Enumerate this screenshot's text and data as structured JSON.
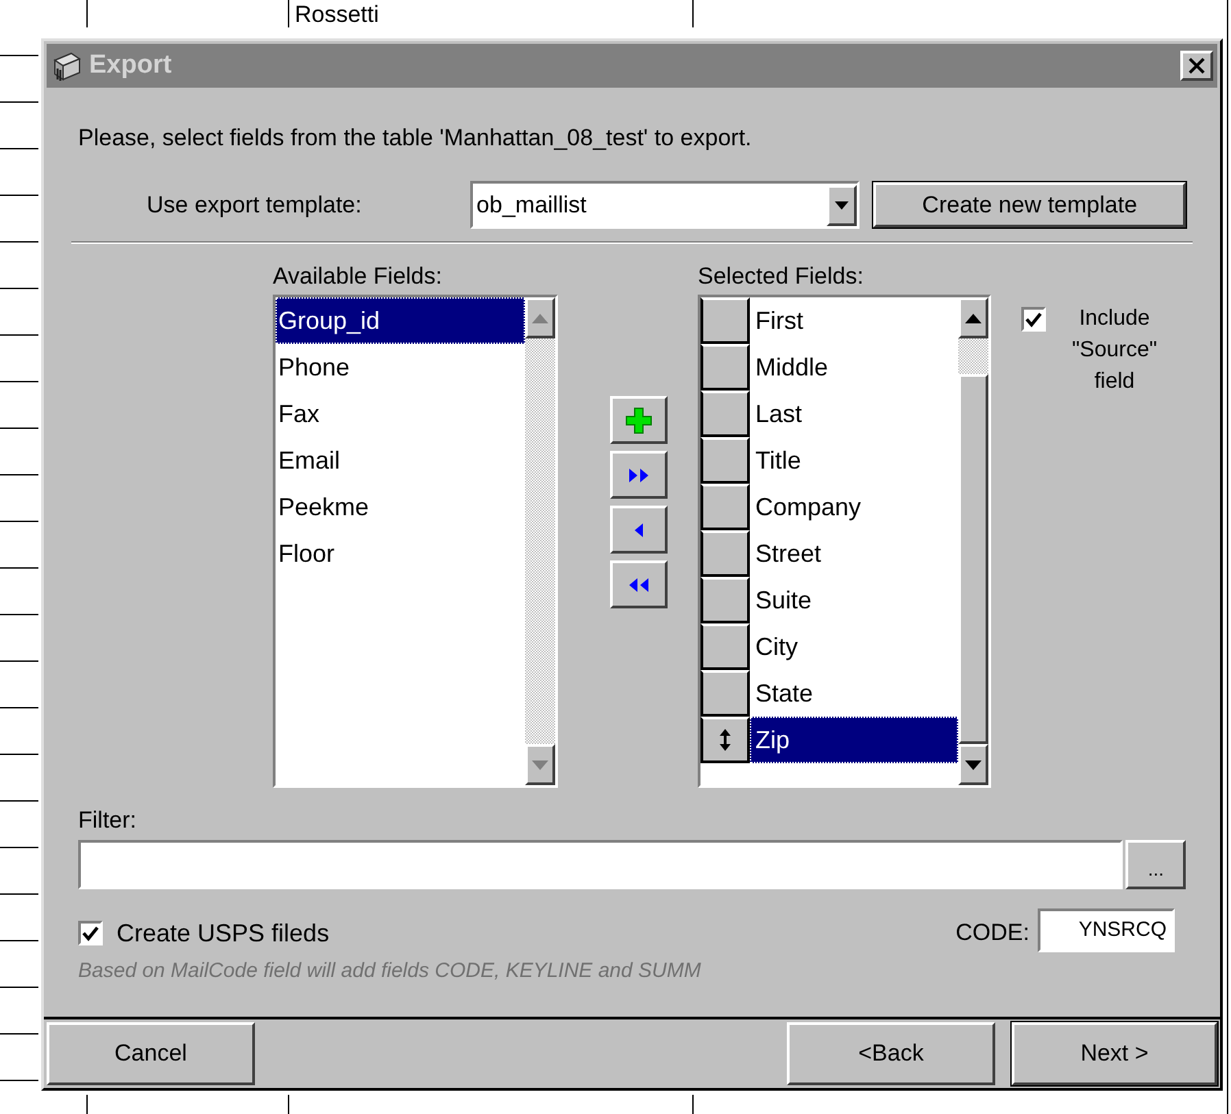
{
  "background_sheet": {
    "cells": [
      "Rossetti"
    ]
  },
  "window": {
    "title": "Export"
  },
  "message": "Please, select fields from the table 'Manhattan_08_test' to export.",
  "template": {
    "label": "Use export template:",
    "value": "ob_maillist",
    "create_button": "Create new template"
  },
  "available_fields": {
    "label": "Available Fields:",
    "items": [
      {
        "label": "Group_id",
        "selected": true
      },
      {
        "label": "Phone",
        "selected": false
      },
      {
        "label": "Fax",
        "selected": false
      },
      {
        "label": "Email",
        "selected": false
      },
      {
        "label": "Peekme",
        "selected": false
      },
      {
        "label": "Floor",
        "selected": false
      }
    ]
  },
  "move_buttons": [
    {
      "kind": "add"
    },
    {
      "kind": "add_all"
    },
    {
      "kind": "remove"
    },
    {
      "kind": "remove_all"
    }
  ],
  "selected_fields": {
    "label": "Selected Fields:",
    "items": [
      {
        "label": "First",
        "selected": false
      },
      {
        "label": "Middle",
        "selected": false
      },
      {
        "label": "Last",
        "selected": false
      },
      {
        "label": "Title",
        "selected": false
      },
      {
        "label": "Company",
        "selected": false
      },
      {
        "label": "Street",
        "selected": false
      },
      {
        "label": "Suite",
        "selected": false
      },
      {
        "label": "City",
        "selected": false
      },
      {
        "label": "State",
        "selected": false
      },
      {
        "label": "Zip",
        "selected": true
      }
    ]
  },
  "include_source": {
    "label": "Include \"Source\" field",
    "checked": true
  },
  "filter": {
    "label": "Filter:",
    "browse_button": "..."
  },
  "usps": {
    "label": "Create USPS fileds",
    "checked": true,
    "code_label": "CODE:",
    "code_value": "YNSRCQ",
    "note": "Based on MailCode field will add fields CODE, KEYLINE and SUMM"
  },
  "buttons": {
    "cancel": "Cancel",
    "back": "<Back",
    "next": "Next >"
  }
}
